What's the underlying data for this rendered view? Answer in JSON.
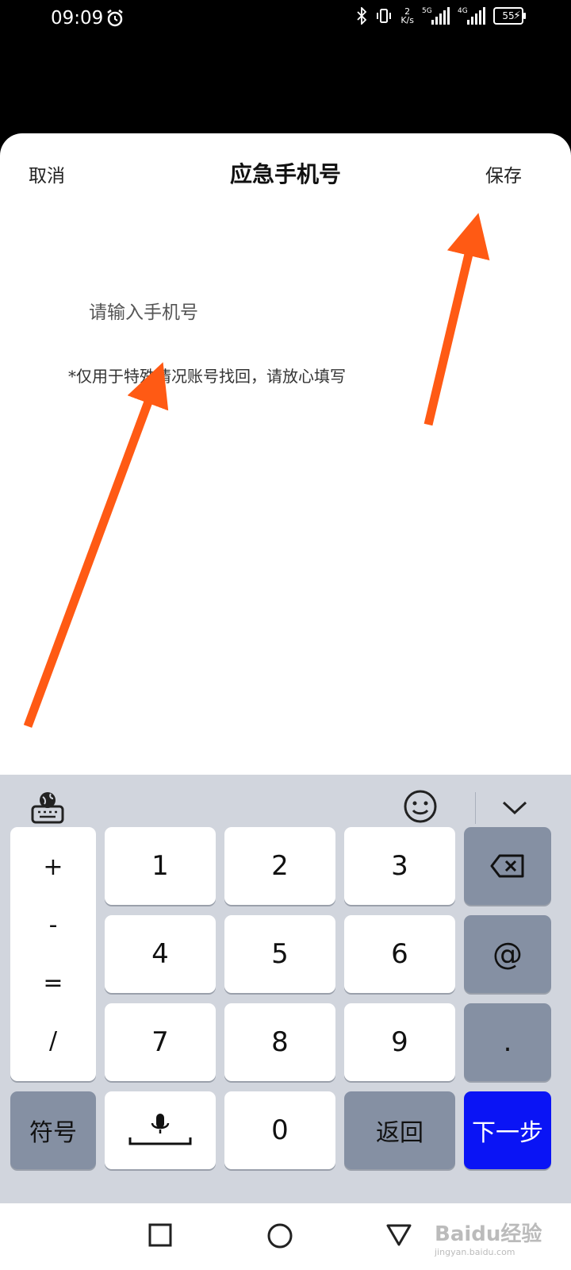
{
  "status_bar": {
    "time": "09:09",
    "net_speed_value": "2",
    "net_speed_unit": "K/s",
    "signal1_tag": "5G",
    "signal2_tag": "4G",
    "battery": "55"
  },
  "header": {
    "cancel_label": "取消",
    "title": "应急手机号",
    "save_label": "保存"
  },
  "form": {
    "phone_placeholder": "请输入手机号",
    "hint": "*仅用于特殊情况账号找回，请放心填写"
  },
  "keyboard": {
    "symbols": [
      "+",
      "-",
      "=",
      "/"
    ],
    "digits": [
      "1",
      "2",
      "3",
      "4",
      "5",
      "6",
      "7",
      "8",
      "9",
      "0"
    ],
    "at_label": "@",
    "dot_label": ".",
    "fuhao_label": "符号",
    "return_label": "返回",
    "next_label": "下一步"
  },
  "watermark": {
    "text": "Baidu经验",
    "url": "jingyan.baidu.com"
  },
  "colors": {
    "arrow": "#ff5a14",
    "next_key": "#0a14f5",
    "dark_key": "#8590a3"
  }
}
